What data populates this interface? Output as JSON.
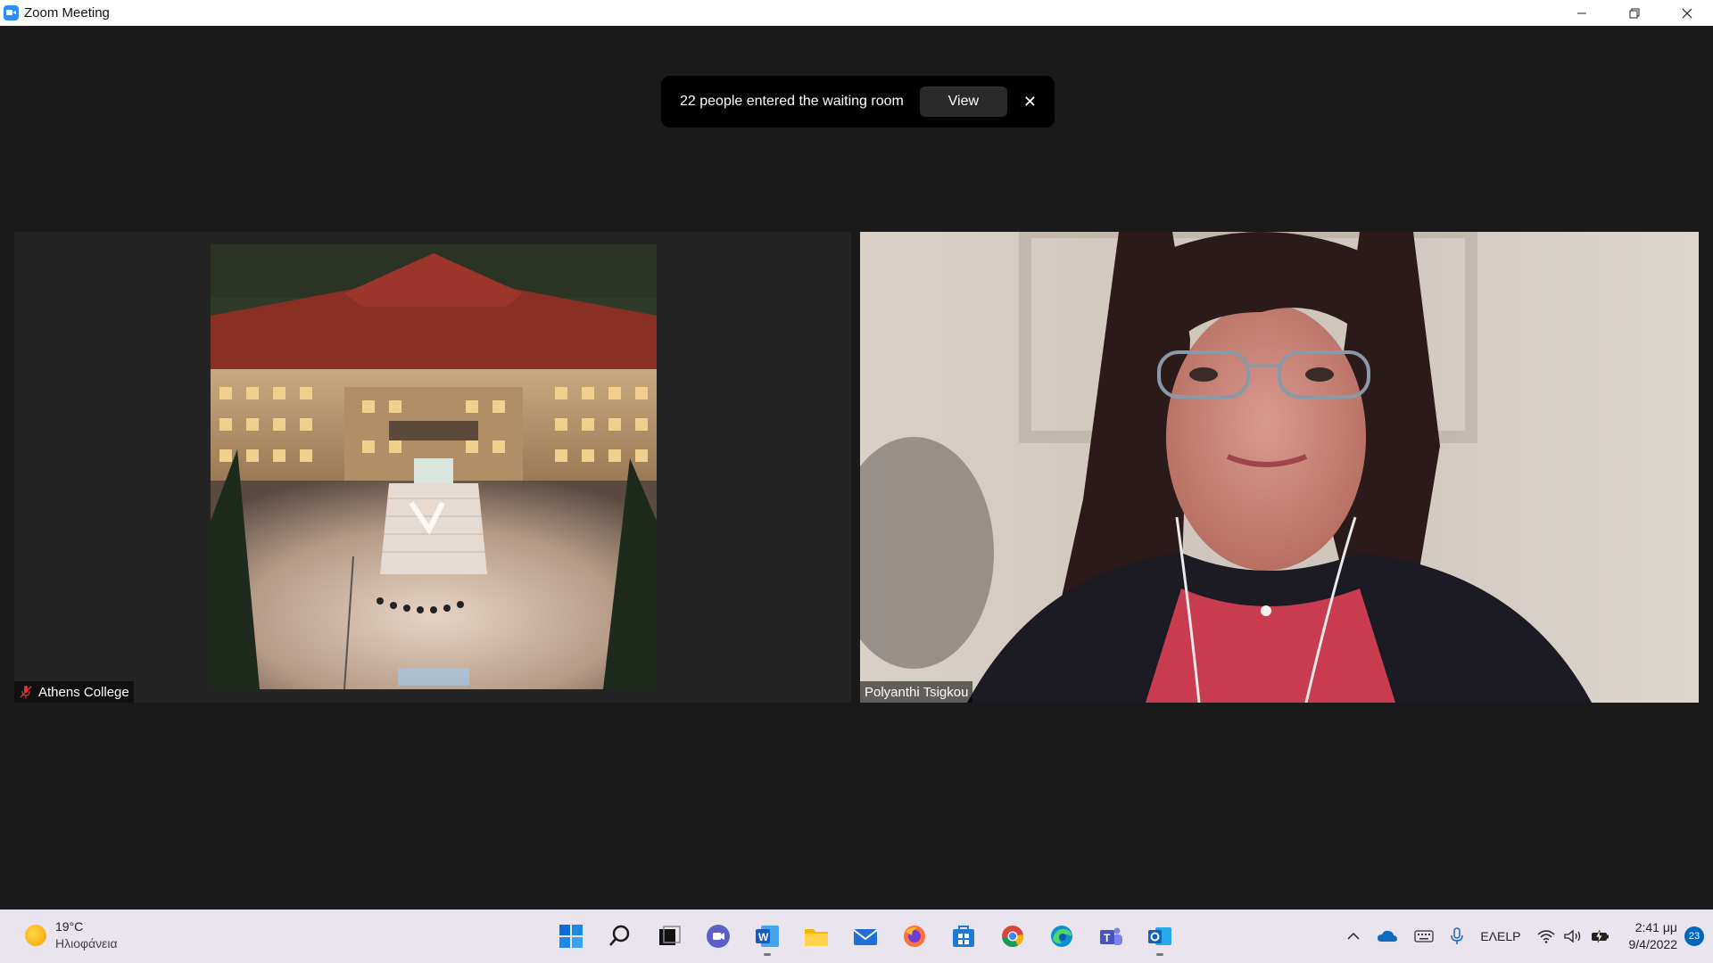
{
  "window": {
    "title": "Zoom Meeting",
    "controls": [
      "minimize",
      "restore",
      "close"
    ]
  },
  "notification": {
    "text": "22 people entered the waiting room",
    "view_label": "View",
    "close_label": "✕"
  },
  "participants": [
    {
      "name": "Athens College",
      "muted": true
    },
    {
      "name": "Polyanthi Tsigkou",
      "muted": false
    }
  ],
  "taskbar": {
    "weather": {
      "temp": "19°C",
      "condition": "Ηλιοφάνεια"
    },
    "apps": [
      "start-icon",
      "search-icon",
      "task-view-icon",
      "teams-chat-icon",
      "word-icon",
      "file-explorer-icon",
      "mail-icon",
      "firefox-icon",
      "store-icon",
      "chrome-icon",
      "edge-icon",
      "teams-icon",
      "outlook-icon"
    ],
    "language": {
      "line1": "ΕΛ",
      "line2": "ELP"
    },
    "clock": {
      "time": "2:41 μμ",
      "date": "9/4/2022"
    },
    "notification_count": "23"
  }
}
